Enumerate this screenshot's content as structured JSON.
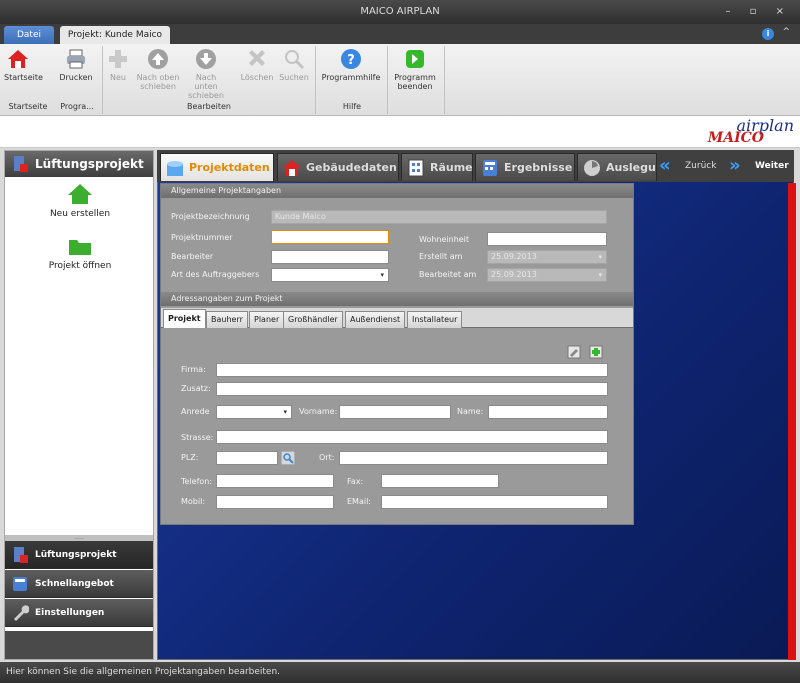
{
  "window": {
    "title": "MAICO AIRPLAN",
    "controls": "– ▫ ×"
  },
  "app_tabs": [
    {
      "label": "Datei"
    },
    {
      "label": "Projekt: Kunde Maico"
    }
  ],
  "ribbon": {
    "buttons": [
      {
        "label": "Startseite"
      },
      {
        "label": "Drucken"
      },
      {
        "label": "Neu"
      },
      {
        "label": "Nach oben schieben"
      },
      {
        "label": "Nach unten schieben"
      },
      {
        "label": "Löschen"
      },
      {
        "label": "Suchen"
      },
      {
        "label": "Programmhilfe"
      },
      {
        "label": "Programm beenden"
      }
    ],
    "groups": [
      {
        "label": "Startseite"
      },
      {
        "label": "Progra..."
      },
      {
        "label": "Bearbeiten"
      },
      {
        "label": "Hilfe"
      }
    ]
  },
  "logo": {
    "line1": "airplan",
    "line2": "MAICO"
  },
  "sidebar": {
    "title": "Lüftungsprojekt",
    "items": [
      {
        "label": "Neu erstellen"
      },
      {
        "label": "Projekt öffnen"
      }
    ],
    "nav": [
      {
        "label": "Lüftungsprojekt"
      },
      {
        "label": "Schnellangebot"
      },
      {
        "label": "Einstellungen"
      }
    ],
    "splitter": "....."
  },
  "main_tabs": [
    {
      "label": "Projektdaten"
    },
    {
      "label": "Gebäudedaten"
    },
    {
      "label": "Räume"
    },
    {
      "label": "Ergebnisse"
    },
    {
      "label": "Auslegu"
    }
  ],
  "nav_buttons": {
    "back": "Zurück",
    "next": "Weiter"
  },
  "general": {
    "heading": "Allgemeine Projektangaben",
    "fields": {
      "projektbezeichnung": {
        "label": "Projektbezeichnung",
        "value": "Kunde Maico"
      },
      "projektnummer": {
        "label": "Projektnummer",
        "value": ""
      },
      "bearbeiter": {
        "label": "Bearbeiter",
        "value": ""
      },
      "art_auftraggeber": {
        "label": "Art des Auftraggebers",
        "value": ""
      },
      "wohneinheit": {
        "label": "Wohneinheit",
        "value": ""
      },
      "erstellt_am": {
        "label": "Erstellt am",
        "value": "25.09.2013"
      },
      "bearbeitet_am": {
        "label": "Bearbeitet am",
        "value": "25.09.2013"
      }
    }
  },
  "address": {
    "heading": "Adressangaben zum Projekt",
    "tabs": [
      {
        "label": "Projekt"
      },
      {
        "label": "Bauherr"
      },
      {
        "label": "Planer"
      },
      {
        "label": "Großhändler"
      },
      {
        "label": "Außendienst"
      },
      {
        "label": "Installateur"
      }
    ],
    "labels": {
      "firma": "Firma:",
      "zusatz": "Zusatz:",
      "anrede": "Anrede",
      "vorname": "Vorname:",
      "name": "Name:",
      "strasse": "Strasse:",
      "plz": "PLZ:",
      "ort": "Ort:",
      "telefon": "Telefon:",
      "fax": "Fax:",
      "mobil": "Mobil:",
      "email": "EMail:"
    }
  },
  "status": {
    "text": "Hier können Sie die allgemeinen Projektangaben bearbeiten."
  }
}
